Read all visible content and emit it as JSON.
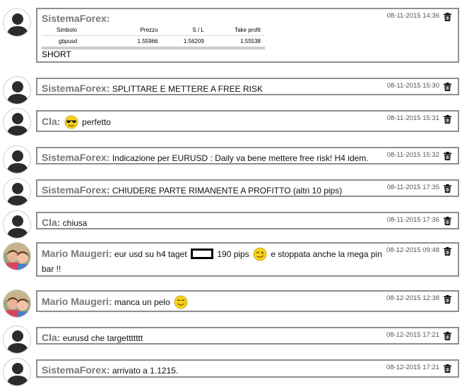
{
  "colors": {
    "author": "#777777",
    "bubble_border": "#8f8f8f",
    "avatar_silhouette": "#2b2b2b"
  },
  "messages": [
    {
      "author": "SistemaForex:",
      "text": "",
      "timestamp": "08-11-2015 14:36",
      "avatar": "default-user-icon",
      "table": {
        "headers": [
          "Simbolo",
          "Prezzo",
          "S / L",
          "Take profit"
        ],
        "row": [
          "gbpusd",
          "1.55966",
          "1.56209",
          "1.55538"
        ]
      },
      "footer": "SHORT"
    },
    {
      "author": "SistemaForex:",
      "text": "SPLITTARE E METTERE A FREE RISK",
      "timestamp": "08-11-2015 15:30",
      "avatar": "default-user-icon"
    },
    {
      "author": "Cla:",
      "emoji": "cool-sunglasses-emoji",
      "text": "perfetto",
      "timestamp": "08-11-2015 15:31",
      "avatar": "default-user-icon"
    },
    {
      "author": "SistemaForex:",
      "text": "Indicazione per EURUSD : Daily va bene mettere free risk! H4 idem.",
      "timestamp": "08-11-2015 15:32",
      "avatar": "default-user-icon"
    },
    {
      "author": "SistemaForex:",
      "text": "CHIUDERE PARTE RIMANENTE A PROFITTO (altri 10 pips)",
      "timestamp": "08-11-2015 17:35",
      "avatar": "default-user-icon"
    },
    {
      "author": "Cla:",
      "text": "chiusa",
      "timestamp": "08-11-2015 17:36",
      "avatar": "default-user-icon"
    },
    {
      "author": "Mario Maugeri:",
      "text_before": "eur usd su h4 taget",
      "text_after": "190 pips",
      "emoji": "winking-emoji",
      "text_end": "e stoppata anche la mega pin",
      "text_line2": "bar !!",
      "timestamp": "08-12-2015 09:48",
      "avatar": "user-photo"
    },
    {
      "author": "Mario Maugeri:",
      "text": "manca un pelo",
      "emoji": "smile-emoji",
      "timestamp": "08-12-2015 12:38",
      "avatar": "user-photo"
    },
    {
      "author": "Cla:",
      "text": "eurusd che targettttttt",
      "timestamp": "08-12-2015 17:21",
      "avatar": "default-user-icon"
    },
    {
      "author": "SistemaForex:",
      "text": "arrivato a 1.1215.",
      "timestamp": "08-12-2015 17:21",
      "avatar": "default-user-icon"
    }
  ]
}
